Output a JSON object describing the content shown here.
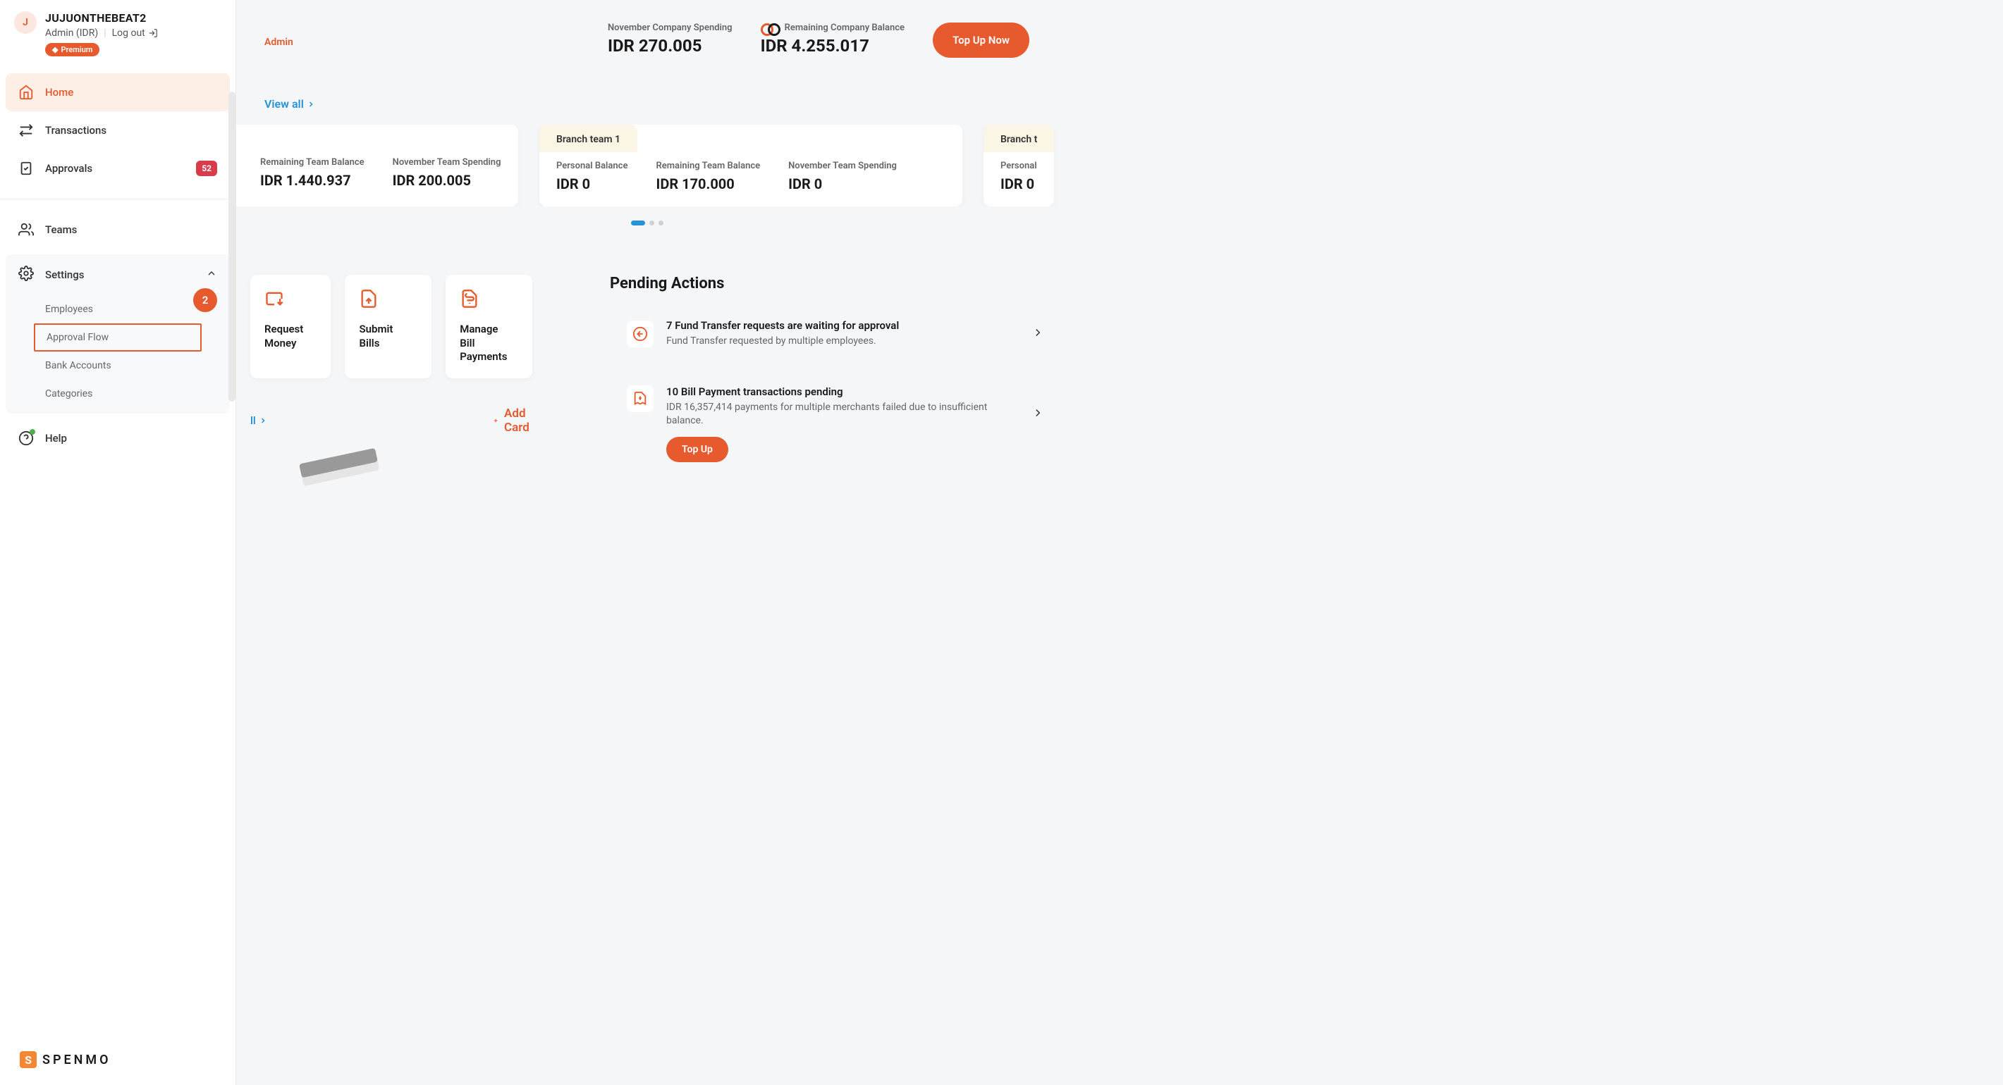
{
  "user": {
    "initial": "J",
    "name": "JUJUONTHEBEAT2",
    "role": "Admin (IDR)",
    "logout": "Log out",
    "premium": "Premium"
  },
  "nav": {
    "home": "Home",
    "transactions": "Transactions",
    "approvals": "Approvals",
    "approvals_count": "52",
    "teams": "Teams",
    "settings": "Settings",
    "employees": "Employees",
    "approval_flow": "Approval Flow",
    "approval_flow_marker": "2",
    "bank_accounts": "Bank Accounts",
    "categories": "Categories",
    "help": "Help"
  },
  "brand": "SPENMO",
  "header": {
    "admin": "Admin",
    "spending_label": "November Company Spending",
    "spending_value": "IDR 270.005",
    "balance_label": "Remaining Company Balance",
    "balance_value": "IDR 4.255.017",
    "topup": "Top Up Now",
    "view_all": "View all"
  },
  "teams": [
    {
      "metrics": [
        {
          "label": "Remaining Team Balance",
          "value": "IDR 1.440.937"
        },
        {
          "label": "November Team Spending",
          "value": "IDR 200.005"
        }
      ]
    },
    {
      "name": "Branch team 1",
      "metrics": [
        {
          "label": "Personal Balance",
          "value": "IDR 0"
        },
        {
          "label": "Remaining Team Balance",
          "value": "IDR 170.000"
        },
        {
          "label": "November Team Spending",
          "value": "IDR 0"
        }
      ]
    },
    {
      "name": "Branch t",
      "metrics": [
        {
          "label": "Personal",
          "value": "IDR 0"
        }
      ]
    }
  ],
  "tiles": {
    "request1": "Request",
    "request2": "Money",
    "submit1": "Submit",
    "submit2": "Bills",
    "manage1": "Manage",
    "manage2": "Bill Payments"
  },
  "pending": {
    "title": "Pending Actions",
    "items": [
      {
        "title": "7 Fund Transfer requests are waiting for approval",
        "sub": "Fund Transfer requested by multiple employees."
      },
      {
        "title": "10 Bill Payment transactions pending",
        "sub": "IDR 16,357,414 payments for multiple merchants failed due to insufficient balance.",
        "action": "Top Up"
      }
    ]
  },
  "bottom": {
    "viewall": "ll",
    "add_card": "Add Card"
  }
}
